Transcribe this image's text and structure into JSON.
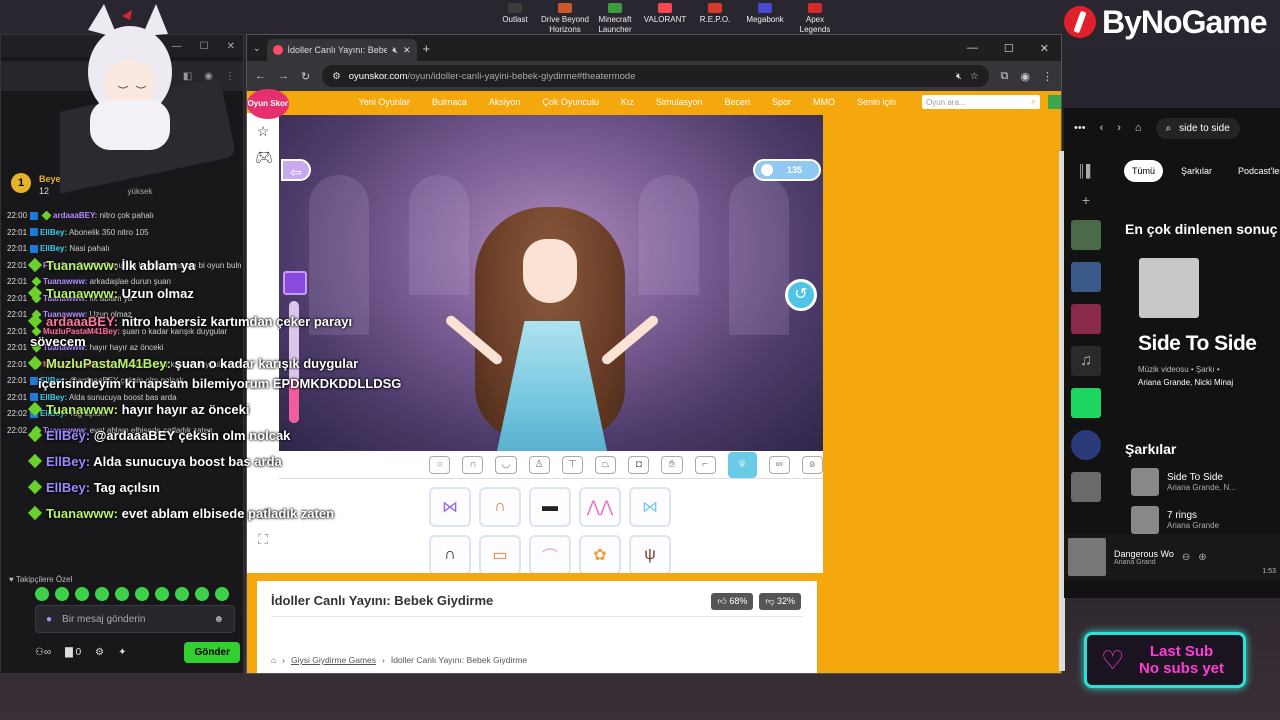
{
  "desktop": {
    "apps": [
      {
        "label": "Outlast",
        "color": "#3b3b3b"
      },
      {
        "label": "Drive Beyond Horizons",
        "color": "#c85a2a"
      },
      {
        "label": "Minecraft Launcher",
        "color": "#3a9c3a"
      },
      {
        "label": "VALORANT",
        "color": "#ff4655"
      },
      {
        "label": "R.E.P.O.",
        "color": "#d43a2a"
      },
      {
        "label": "Megabonk",
        "color": "#4a4ad0"
      },
      {
        "label": "Apex Legends",
        "color": "#d02a2a"
      }
    ],
    "brand": "ByNoGame"
  },
  "chat": {
    "header_name": "Beyefend",
    "header_count": "12",
    "header_extra": "yüksek",
    "lines": [
      {
        "time": "22:00",
        "user": "ardaaaBEY:",
        "text": "nitro çok pahalı"
      },
      {
        "time": "22:01",
        "user": "EllBey:",
        "text": "Abonelik 350 nitro 105"
      },
      {
        "time": "22:01",
        "user": "EllBey:",
        "text": "Nasi pahalı"
      },
      {
        "time": "22:01",
        "user": "FirstStepToKill:",
        "text": "Sonunda kendini yansıtan bi oyun bulmuşsun :)"
      },
      {
        "time": "22:01",
        "user": "Tuanawww:",
        "text": "arkadaşlae durun şuan"
      },
      {
        "time": "22:01",
        "user": "Tuanawww:",
        "text": "İlk ablam ya"
      },
      {
        "time": "22:01",
        "user": "Tuanawww:",
        "text": "Uzun olmaz"
      },
      {
        "time": "22:01",
        "user": "MuzluPastaM41Bey:",
        "text": "şuan o kadar karışık duygular"
      },
      {
        "time": "22:01",
        "user": "Tuanawww:",
        "text": "hayır hayır az önceki"
      },
      {
        "time": "22:01",
        "user": "MuzluPastaM41Bey:",
        "text": "şuan o kadar karışık duygular içerisindeyim ki napsam bilemiyorum EPDMKDKDDLLDSG"
      },
      {
        "time": "22:01",
        "user": "EllBey:",
        "text": "@ardaaaBEY çeksin olm nolcak"
      },
      {
        "time": "22:01",
        "user": "EllBey:",
        "text": "Alda sunucuya boost bas arda"
      },
      {
        "time": "22:02",
        "user": "EllBey:",
        "text": "Tag açılsın"
      },
      {
        "time": "22:02",
        "user": "Tuanawww:",
        "text": "evet ablam elbisede patladık zaten"
      }
    ],
    "emote_label": "Takipçilere Özel",
    "input_placeholder": "Bir mesaj gönderin",
    "send": "Gönder",
    "count_zero": "0"
  },
  "overlay": [
    {
      "user": "Tuanawww:",
      "text": "İlk ablam ya"
    },
    {
      "user": "Tuanawww:",
      "text": "Uzun olmaz"
    },
    {
      "user": "ardaaaBEY:",
      "text": "nitro habersiz kartımdan çeker parayı sövecem"
    },
    {
      "user": "MuzluPastaM41Bey:",
      "text": "şuan o kadar karışık duygular"
    },
    {
      "user": "",
      "text": "içerisindeyim ki napsam bilemiyorum EPDMKDKDDLLDSG"
    },
    {
      "user": "Tuanawww:",
      "text": "hayır hayır az önceki"
    },
    {
      "user": "EllBey:",
      "text": "@ardaaaBEY çeksin olm nolcak"
    },
    {
      "user": "EllBey:",
      "text": "Alda sunucuya boost bas arda"
    },
    {
      "user": "EllBey:",
      "text": "Tag açılsın"
    },
    {
      "user": "Tuanawww:",
      "text": "evet ablam elbisede patladık zaten"
    }
  ],
  "browser": {
    "tab_title": "İdoller Canlı Yayını: Bebek G",
    "url_host": "oyunskor.com",
    "url_path": "/oyun/idoller-canli-yayini-bebek-giydirme#theatermode"
  },
  "site": {
    "logo": "Oyun Skor",
    "nav": [
      "Yeni Oyunlar",
      "Bulmaca",
      "Aksiyon",
      "Çok Oyunculu",
      "Kız",
      "Simulasyon",
      "Beceri",
      "Spor",
      "MMO",
      "Senin için"
    ],
    "search_placeholder": "Oyun ara...",
    "score": "135",
    "slider_level": 0.35,
    "title": "İdoller Canlı Yayını: Bebek Giydirme",
    "likes": "68%",
    "dislikes": "32%",
    "crumb_link": "Giysi Giydirme Games",
    "crumb_current": "İdoller Canlı Yayını: Bebek Giydirme"
  },
  "spotify": {
    "search": "side to side",
    "filters": [
      "Tümü",
      "Şarkılar",
      "Podcast'ler"
    ],
    "top_heading": "En çok dinlenen sonuç",
    "top_title": "Side To Side",
    "top_meta": "Müzik videosu • Şarkı •",
    "top_artists": "Ariana Grande, Nicki Minaj",
    "songs_heading": "Şarkılar",
    "songs": [
      {
        "name": "Side To Side",
        "artist": "Ariana Grande, N..."
      },
      {
        "name": "7 rings",
        "artist": "Ariana Grande"
      }
    ],
    "now_playing": {
      "name": "Dangerous Wo",
      "artist": "Ariana Grand",
      "time": "1:53"
    }
  },
  "last_sub": {
    "line1": "Last Sub",
    "line2": "No subs yet"
  }
}
